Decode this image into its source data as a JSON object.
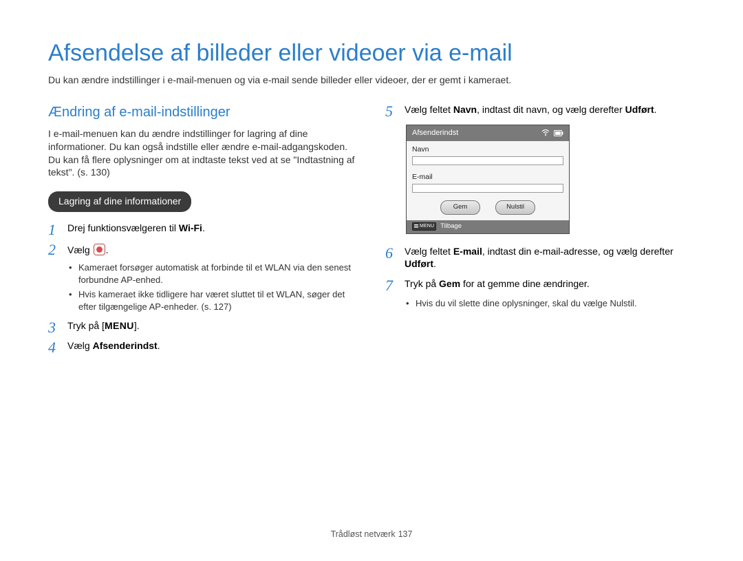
{
  "page": {
    "title": "Afsendelse af billeder eller videoer via e-mail",
    "intro": "Du kan ændre indstillinger i e-mail-menuen og via e-mail sende billeder eller videoer, der er gemt i kameraet."
  },
  "section": {
    "title": "Ændring af e-mail-indstillinger",
    "desc": "I e-mail-menuen kan du ændre indstillinger for lagring af dine informationer. Du kan også indstille eller ændre e-mail-adgangskoden. Du kan få flere oplysninger om at indtaste tekst ved at se \"Indtastning af tekst\". (s. 130)",
    "pill": "Lagring af dine informationer"
  },
  "steps_left": {
    "s1_pre": "Drej funktionsvælgeren til ",
    "s1_wifi": "Wi-Fi",
    "s1_post": ".",
    "s2_pre": "Vælg ",
    "s2_post": ".",
    "s2_bullets": [
      "Kameraet forsøger automatisk at forbinde til et WLAN via den senest forbundne AP-enhed.",
      "Hvis kameraet ikke tidligere har været sluttet til et WLAN, søger det efter tilgængelige AP-enheder. (s. 127)"
    ],
    "s3_pre": "Tryk på [",
    "s3_menu": "MENU",
    "s3_post": "].",
    "s4_pre": "Vælg ",
    "s4_bold": "Afsenderindst",
    "s4_post": "."
  },
  "steps_right": {
    "s5_pre": "Vælg feltet ",
    "s5_b1": "Navn",
    "s5_mid": ", indtast dit navn, og vælg derefter ",
    "s5_b2": "Udført",
    "s5_post": ".",
    "s6_pre": "Vælg feltet ",
    "s6_b1": "E-mail",
    "s6_mid": ", indtast din e-mail-adresse, og vælg derefter ",
    "s6_b2": "Udført",
    "s6_post": ".",
    "s7_pre": "Tryk på ",
    "s7_b": "Gem",
    "s7_post": " for at gemme dine ændringer.",
    "s7_bullet_pre": "Hvis du vil slette dine oplysninger, skal du vælge ",
    "s7_bullet_b": "Nulstil",
    "s7_bullet_post": "."
  },
  "camera": {
    "title": "Afsenderindst",
    "row_name": "Navn",
    "row_email": "E-mail",
    "btn_save": "Gem",
    "btn_reset": "Nulstil",
    "footer_menu": "MENU",
    "footer_back": "Tilbage"
  },
  "footer": {
    "section": "Trådløst netværk",
    "page": "137"
  }
}
